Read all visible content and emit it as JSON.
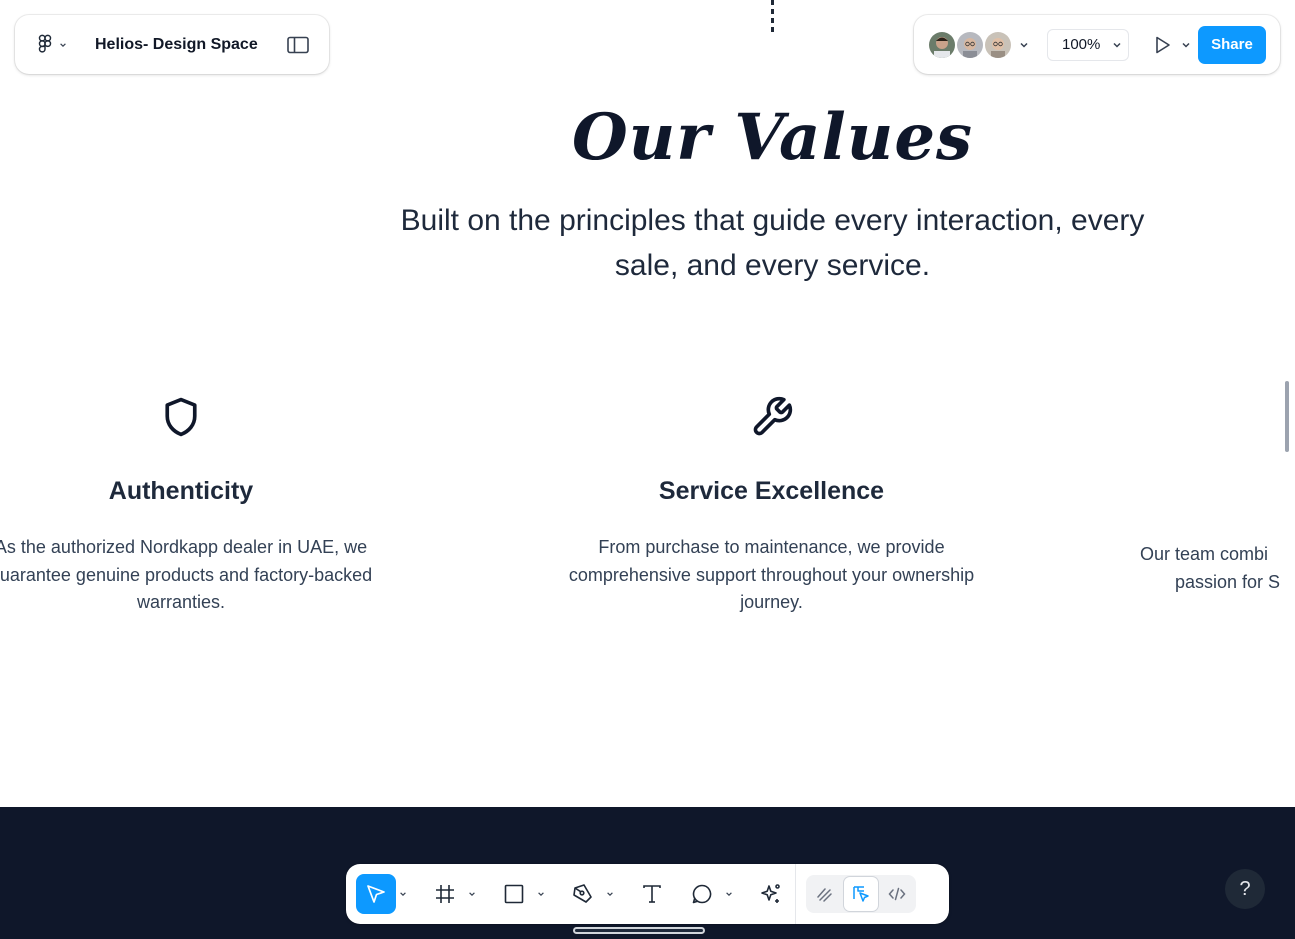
{
  "header": {
    "file_title": "Helios- Design Space",
    "zoom_level": "100%",
    "share_label": "Share",
    "avatars": [
      "avatar-1",
      "avatar-2",
      "avatar-3"
    ]
  },
  "canvas": {
    "title": "Our Values",
    "subtitle": "Built on the principles that guide every interaction, every sale, and every service.",
    "cards": [
      {
        "icon": "shield-icon",
        "title": "Authenticity",
        "text": "As the authorized Nordkapp dealer in UAE, we guarantee genuine products and factory-backed warranties."
      },
      {
        "icon": "wrench-icon",
        "title": "Service Excellence",
        "text": "From purchase to maintenance, we provide comprehensive support throughout your ownership journey."
      },
      {
        "text_line1": "Our team combi",
        "text_line2": "passion for S"
      }
    ]
  },
  "toolbar": {
    "tools": [
      "move-tool",
      "frame-tool",
      "shape-tool",
      "pen-tool",
      "text-tool",
      "comment-tool",
      "actions-tool"
    ],
    "modes": [
      "draw-mode",
      "design-mode",
      "dev-mode"
    ]
  },
  "help_label": "?",
  "colors": {
    "accent": "#0d99ff",
    "dark_band": "#0f172a",
    "text": "#0f172a"
  }
}
